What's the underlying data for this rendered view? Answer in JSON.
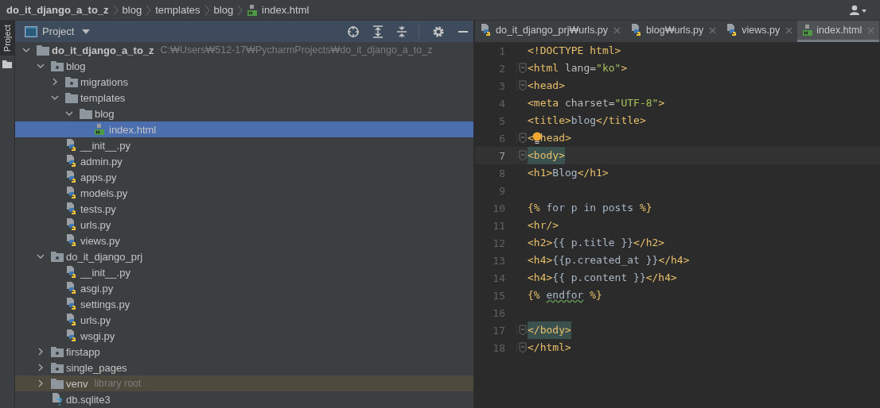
{
  "breadcrumbs": [
    {
      "label": "do_it_django_a_to_z",
      "kind": "project"
    },
    {
      "label": "blog",
      "kind": "folder"
    },
    {
      "label": "templates",
      "kind": "folder"
    },
    {
      "label": "blog",
      "kind": "folder"
    },
    {
      "label": "index.html",
      "kind": "html"
    }
  ],
  "side_strip": {
    "label": "Project"
  },
  "project_panel": {
    "title": "Project",
    "tree": [
      {
        "label": "do_it_django_a_to_z",
        "kind": "project",
        "hint": "C:₩Users₩512-17₩PycharmProjects₩do_it_django_a_to_z",
        "expanded": true,
        "selected": false,
        "children": [
          {
            "label": "blog",
            "kind": "package",
            "expanded": true,
            "selected": false,
            "children": [
              {
                "label": "migrations",
                "kind": "package",
                "expanded": false,
                "selected": false
              },
              {
                "label": "templates",
                "kind": "folder",
                "expanded": true,
                "selected": false,
                "children": [
                  {
                    "label": "blog",
                    "kind": "folder",
                    "expanded": true,
                    "selected": false,
                    "children": [
                      {
                        "label": "index.html",
                        "kind": "html",
                        "selected": true
                      }
                    ]
                  }
                ]
              },
              {
                "label": "__init__.py",
                "kind": "python",
                "selected": false
              },
              {
                "label": "admin.py",
                "kind": "python",
                "selected": false
              },
              {
                "label": "apps.py",
                "kind": "python",
                "selected": false
              },
              {
                "label": "models.py",
                "kind": "python",
                "selected": false
              },
              {
                "label": "tests.py",
                "kind": "python",
                "selected": false
              },
              {
                "label": "urls.py",
                "kind": "python",
                "selected": false
              },
              {
                "label": "views.py",
                "kind": "python",
                "selected": false
              }
            ]
          },
          {
            "label": "do_it_django_prj",
            "kind": "package",
            "expanded": true,
            "selected": false,
            "children": [
              {
                "label": "__init__.py",
                "kind": "python",
                "selected": false
              },
              {
                "label": "asgi.py",
                "kind": "python",
                "selected": false
              },
              {
                "label": "settings.py",
                "kind": "python",
                "selected": false
              },
              {
                "label": "urls.py",
                "kind": "python",
                "selected": false
              },
              {
                "label": "wsgi.py",
                "kind": "python",
                "selected": false
              }
            ]
          },
          {
            "label": "firstapp",
            "kind": "package",
            "expanded": false,
            "selected": false
          },
          {
            "label": "single_pages",
            "kind": "package",
            "expanded": false,
            "selected": false
          },
          {
            "label": "venv",
            "kind": "folder",
            "hint": "library root",
            "library_root": true,
            "expanded": false,
            "selected": false
          },
          {
            "label": "db.sqlite3",
            "kind": "unknown",
            "selected": false
          }
        ]
      }
    ]
  },
  "editor": {
    "tabs": [
      {
        "label": "do_it_django_prj₩urls.py",
        "kind": "python",
        "selected": false
      },
      {
        "label": "blog₩urls.py",
        "kind": "python",
        "selected": false
      },
      {
        "label": "views.py",
        "kind": "python",
        "selected": false
      },
      {
        "label": "index.html",
        "kind": "html",
        "selected": true
      }
    ],
    "lines": [
      {
        "number": "1",
        "current": false,
        "fold": false,
        "segments": [
          {
            "text": "<!DOCTYPE html>",
            "kind": "tag"
          }
        ]
      },
      {
        "number": "2",
        "current": false,
        "fold": true,
        "segments": [
          {
            "text": "<html ",
            "kind": "tag"
          },
          {
            "text": "lang=",
            "kind": "attr"
          },
          {
            "text": "\"ko\"",
            "kind": "string"
          },
          {
            "text": ">",
            "kind": "tag"
          }
        ]
      },
      {
        "number": "3",
        "current": false,
        "fold": true,
        "segments": [
          {
            "text": "<head>",
            "kind": "tag"
          }
        ]
      },
      {
        "number": "4",
        "current": false,
        "fold": false,
        "segments": [
          {
            "text": "<meta ",
            "kind": "tag"
          },
          {
            "text": "charset=",
            "kind": "attr"
          },
          {
            "text": "\"UTF-8\"",
            "kind": "string"
          },
          {
            "text": ">",
            "kind": "tag"
          }
        ]
      },
      {
        "number": "5",
        "current": false,
        "fold": false,
        "segments": [
          {
            "text": "<title>",
            "kind": "tag"
          },
          {
            "text": "blog",
            "kind": "text"
          },
          {
            "text": "</title>",
            "kind": "tag"
          }
        ]
      },
      {
        "number": "6",
        "current": false,
        "fold": true,
        "segments": [
          {
            "text": "<",
            "kind": "tag"
          },
          {
            "kind": "bulb"
          },
          {
            "text": "head>",
            "kind": "tag"
          }
        ]
      },
      {
        "number": "7",
        "current": true,
        "fold": true,
        "segments": [
          {
            "text": "<body>",
            "kind": "match"
          }
        ]
      },
      {
        "number": "8",
        "current": false,
        "fold": false,
        "segments": [
          {
            "text": "<h1>",
            "kind": "tag"
          },
          {
            "text": "Blog",
            "kind": "text"
          },
          {
            "text": "</h1>",
            "kind": "tag"
          }
        ]
      },
      {
        "number": "9",
        "current": false,
        "fold": false
      },
      {
        "number": "10",
        "current": false,
        "fold": false,
        "segments": [
          {
            "text": "{%",
            "kind": "brace"
          },
          {
            "text": " for p in posts ",
            "kind": "text"
          },
          {
            "text": "%}",
            "kind": "brace"
          }
        ]
      },
      {
        "number": "11",
        "current": false,
        "fold": false,
        "segments": [
          {
            "text": "<hr/>",
            "kind": "tag"
          }
        ]
      },
      {
        "number": "12",
        "current": false,
        "fold": false,
        "segments": [
          {
            "text": "<h2>",
            "kind": "tag"
          },
          {
            "text": "{{ p.title }}",
            "kind": "text"
          },
          {
            "text": "</h2>",
            "kind": "tag"
          }
        ]
      },
      {
        "number": "13",
        "current": false,
        "fold": false,
        "segments": [
          {
            "text": "<h4>",
            "kind": "tag"
          },
          {
            "text": "{{p.created_at }}",
            "kind": "text"
          },
          {
            "text": "</h4>",
            "kind": "tag"
          }
        ]
      },
      {
        "number": "14",
        "current": false,
        "fold": false,
        "segments": [
          {
            "text": "<h4>",
            "kind": "tag"
          },
          {
            "text": "{{ p.content }}",
            "kind": "text"
          },
          {
            "text": "</h4>",
            "kind": "tag"
          }
        ]
      },
      {
        "number": "15",
        "current": false,
        "fold": false,
        "segments": [
          {
            "text": "{% ",
            "kind": "brace"
          },
          {
            "text": "endfor",
            "kind": "warn"
          },
          {
            "text": " %}",
            "kind": "brace"
          }
        ]
      },
      {
        "number": "16",
        "current": false,
        "fold": false
      },
      {
        "number": "17",
        "current": false,
        "fold": true,
        "segments": [
          {
            "text": "</body>",
            "kind": "match"
          }
        ]
      },
      {
        "number": "18",
        "current": false,
        "fold": true,
        "segments": [
          {
            "text": "</html>",
            "kind": "tag"
          }
        ]
      }
    ]
  }
}
